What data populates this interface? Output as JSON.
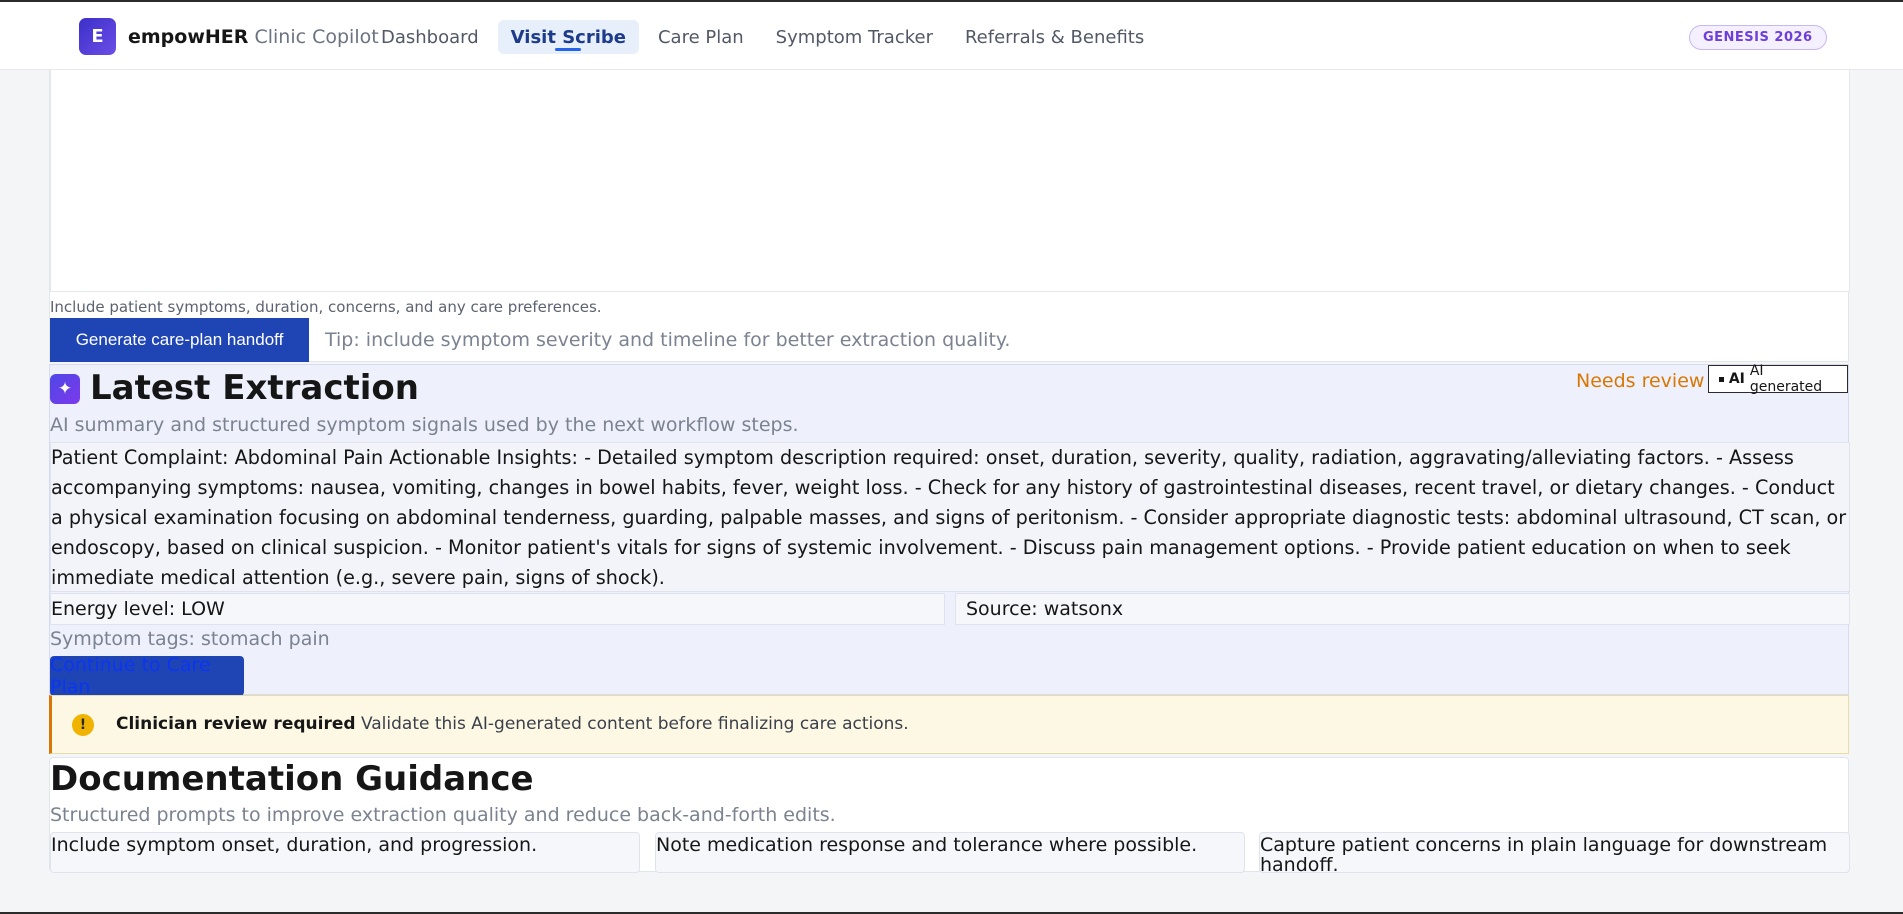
{
  "header": {
    "logo_letter": "E",
    "brand_name": "empowHER",
    "brand_sub": "Clinic Copilot",
    "nav": [
      {
        "label": "Dashboard",
        "active": false
      },
      {
        "label": "Visit Scribe",
        "active": true
      },
      {
        "label": "Care Plan",
        "active": false
      },
      {
        "label": "Symptom Tracker",
        "active": false
      },
      {
        "label": "Referrals & Benefits",
        "active": false
      }
    ],
    "badge": "GENESIS 2026"
  },
  "input": {
    "textarea_value": "",
    "helper": "Include patient symptoms, duration, concerns, and any care preferences.",
    "generate_label": "Generate care-plan handoff",
    "tip": "Tip: include symptom severity and timeline for better extraction quality."
  },
  "extraction": {
    "title": "Latest Extraction",
    "needs_review": "Needs review",
    "ai_tag_bold": "AI",
    "ai_tag_label": "AI generated",
    "subtitle": "AI summary and structured symptom signals used by the next workflow steps.",
    "summary": "Patient Complaint: Abdominal Pain Actionable Insights: - Detailed symptom description required: onset, duration, severity, quality, radiation, aggravating/alleviating factors. - Assess accompanying symptoms: nausea, vomiting, changes in bowel habits, fever, weight loss. - Check for any history of gastrointestinal diseases, recent travel, or dietary changes. - Conduct a physical examination focusing on abdominal tenderness, guarding, palpable masses, and signs of peritonism. - Consider appropriate diagnostic tests: abdominal ultrasound, CT scan, or endoscopy, based on clinical suspicion. - Monitor patient's vitals for signs of systemic involvement. - Discuss pain management options. - Provide patient education on when to seek immediate medical attention (e.g., severe pain, signs of shock).",
    "energy": "Energy level: LOW",
    "source": "Source: watsonx",
    "tags": "Symptom tags: stomach pain",
    "continue_label": "Continue to Care Plan"
  },
  "alert": {
    "icon": "!",
    "title": "Clinician review required",
    "message": "Validate this AI-generated content before finalizing care actions."
  },
  "guidance": {
    "title": "Documentation Guidance",
    "subtitle": "Structured prompts to improve extraction quality and reduce back-and-forth edits.",
    "cards": [
      "Include symptom onset, duration, and progression.",
      "Note medication response and tolerance where possible.",
      "Capture patient concerns in plain language for downstream handoff."
    ]
  },
  "colors": {
    "primary": "#1f45b5",
    "accent": "#6d3fd8",
    "warning": "#d97706",
    "panel": "#eef1fb"
  }
}
